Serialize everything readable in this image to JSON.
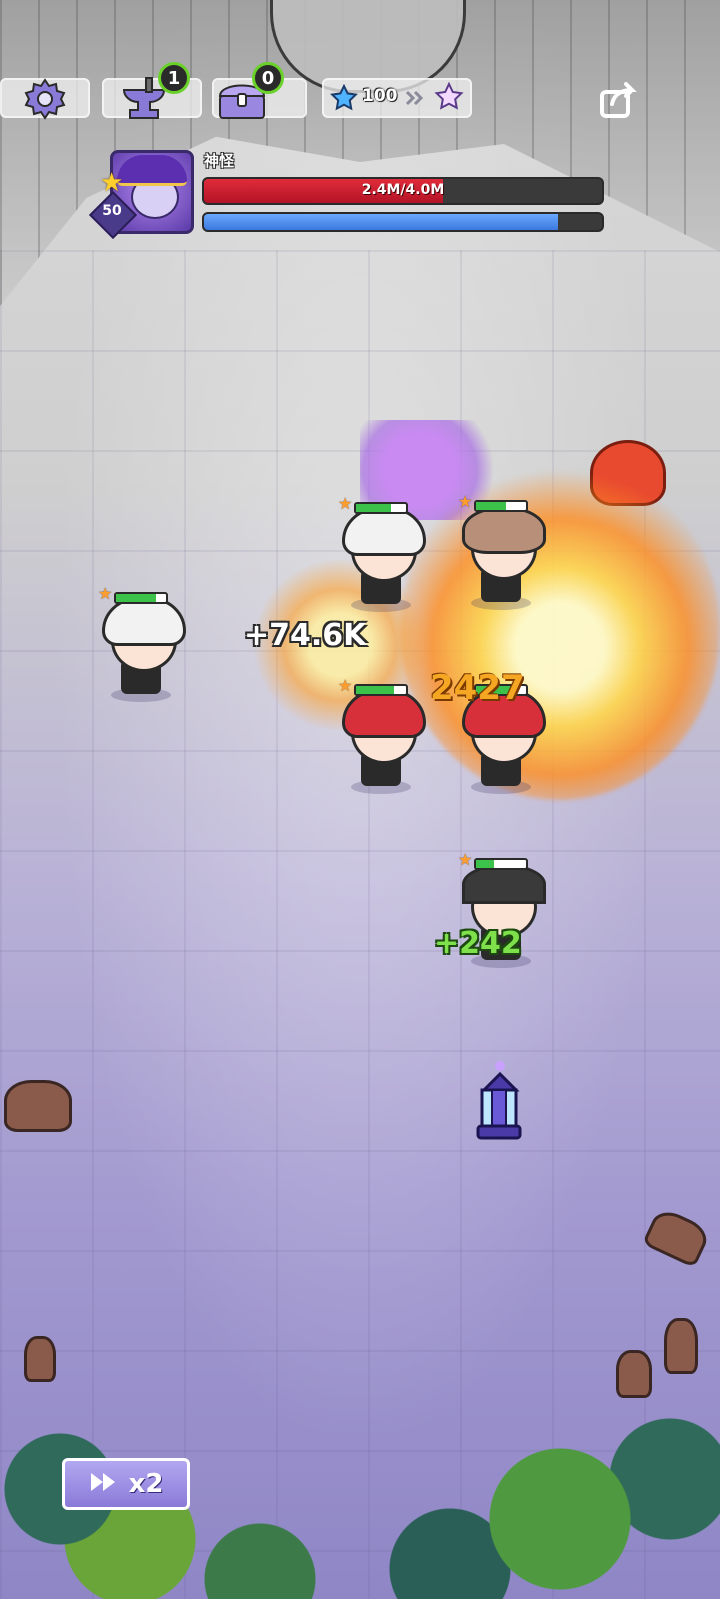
{
  "hud": {
    "forge_count": "1",
    "chest_count": "0",
    "currency_value": "100"
  },
  "boss": {
    "name": "神怪",
    "level": "50",
    "hp_text": "2.4M/4.0M",
    "hp_fraction": 0.6,
    "shield_fraction": 0.89
  },
  "combat_text": {
    "heal_white": "+74.6K",
    "damage_orange": "2427",
    "heal_green": "+242"
  },
  "speed": {
    "label": "x2"
  },
  "colors": {
    "hp": "#d11f2f",
    "shield": "#4f8ff0",
    "heal_green": "#7ee04a",
    "damage": "#f5a623",
    "accent_purple": "#8a7ad8"
  }
}
